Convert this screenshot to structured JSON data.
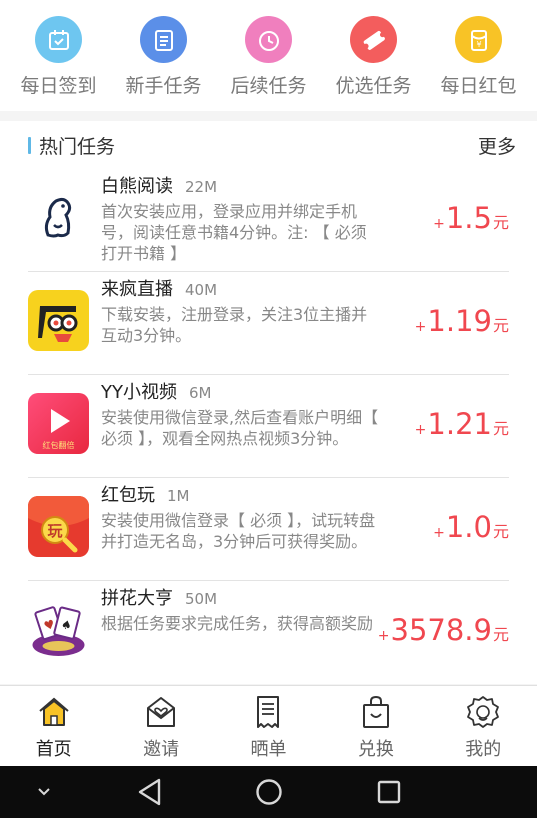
{
  "quick_entries": [
    {
      "label": "每日签到",
      "icon": "calendar-check-icon",
      "color": "#6ec6f0"
    },
    {
      "label": "新手任务",
      "icon": "notepad-icon",
      "color": "#5b8fe8"
    },
    {
      "label": "后续任务",
      "icon": "clock-icon",
      "color": "#f07fbe"
    },
    {
      "label": "优选任务",
      "icon": "ticket-icon",
      "color": "#f35d5d"
    },
    {
      "label": "每日红包",
      "icon": "red-envelope-icon",
      "color": "#f8c326"
    }
  ],
  "hot_tasks": {
    "title": "热门任务",
    "more_label": "更多",
    "accent": "#5fb8e6",
    "items": [
      {
        "name": "白熊阅读",
        "size": "22M",
        "desc": "首次安装应用，登录应用并绑定手机号，阅读任意书籍4分钟。注: 【 必须打开书籍 】",
        "plus": "+",
        "amount": "1.5",
        "unit": "元"
      },
      {
        "name": "来疯直播",
        "size": "40M",
        "desc": "下载安装，注册登录，关注3位主播并互动3分钟。",
        "plus": "+",
        "amount": "1.19",
        "unit": "元"
      },
      {
        "name": "YY小视频",
        "size": "6M",
        "desc": "安装使用微信登录,然后查看账户明细【 必须 】，观看全网热点视频3分钟。",
        "plus": "+",
        "amount": "1.21",
        "unit": "元",
        "icon_text": "红包翻倍"
      },
      {
        "name": "红包玩",
        "size": "1M",
        "desc": "安装使用微信登录【 必须 】，试玩转盘并打造无名岛，3分钟后可获得奖励。",
        "plus": "+",
        "amount": "1.0",
        "unit": "元",
        "icon_text": "玩"
      },
      {
        "name": "拼花大亨",
        "size": "50M",
        "desc": "根据任务要求完成任务，获得高额奖励",
        "plus": "+",
        "amount": "3578.9",
        "unit": "元"
      }
    ]
  },
  "tabbar": [
    {
      "label": "首页",
      "icon": "home-icon",
      "active": true
    },
    {
      "label": "邀请",
      "icon": "heart-envelope-icon",
      "active": false
    },
    {
      "label": "晒单",
      "icon": "receipt-icon",
      "active": false
    },
    {
      "label": "兑换",
      "icon": "shopping-bag-icon",
      "active": false
    },
    {
      "label": "我的",
      "icon": "profile-badge-icon",
      "active": false
    }
  ],
  "colors": {
    "reward": "#f0474f",
    "home_active": "#f8c326"
  }
}
